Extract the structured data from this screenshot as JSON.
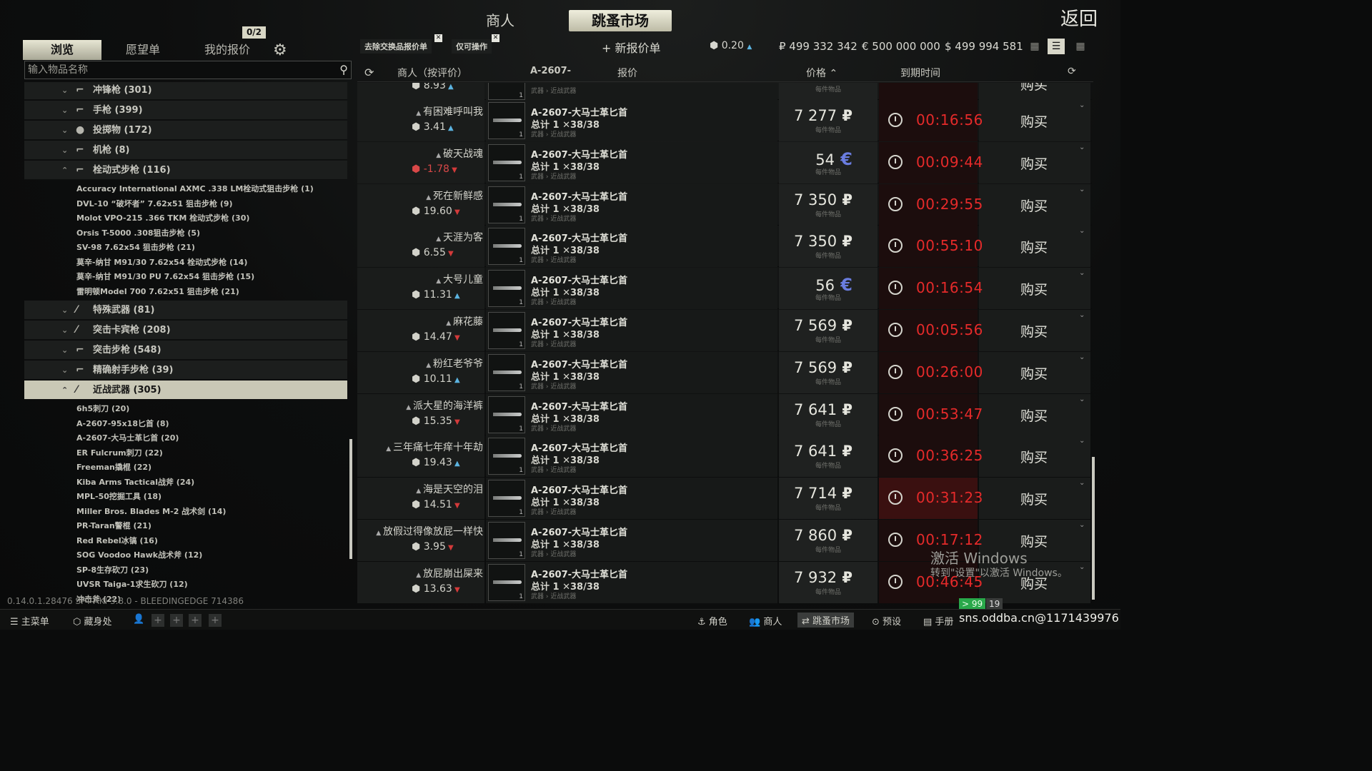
{
  "top": {
    "traders": "商人",
    "flea": "跳蚤市场",
    "back": "返回"
  },
  "left_tabs": {
    "browse": "浏览",
    "wishlist": "愿望单",
    "my_offers": "我的报价",
    "offer_count": "0/2"
  },
  "search": {
    "placeholder": "输入物品名称"
  },
  "categories_top": [
    {
      "label": "冲锋枪 (301)",
      "chev": "⌄",
      "icon": "⌐"
    },
    {
      "label": "手枪 (399)",
      "chev": "⌄",
      "icon": "⌐"
    },
    {
      "label": "投掷物 (172)",
      "chev": "⌄",
      "icon": "●"
    },
    {
      "label": "机枪 (8)",
      "chev": "⌄",
      "icon": "⌐"
    },
    {
      "label": "栓动式步枪 (116)",
      "chev": "⌃",
      "icon": "⌐"
    }
  ],
  "bolt_subitems": [
    "Accuracy International AXMC .338 LM栓动式狙击步枪 (1)",
    "DVL-10 “破坏者” 7.62x51 狙击步枪 (9)",
    "Molot VPO-215 .366 TKM 栓动式步枪 (30)",
    "Orsis T-5000 .308狙击步枪 (5)",
    "SV-98 7.62x54 狙击步枪 (21)",
    "莫辛-纳甘 M91/30 7.62x54 栓动式步枪 (14)",
    "莫辛-纳甘 M91/30 PU 7.62x54 狙击步枪 (15)",
    "雷明顿Model 700 7.62x51 狙击步枪 (21)"
  ],
  "categories_mid": [
    {
      "label": "特殊武器 (81)",
      "chev": "⌄",
      "icon": "⁄"
    },
    {
      "label": "突击卡宾枪 (208)",
      "chev": "⌄",
      "icon": "⁄"
    },
    {
      "label": "突击步枪 (548)",
      "chev": "⌄",
      "icon": "⌐"
    },
    {
      "label": "精确射手步枪 (39)",
      "chev": "⌄",
      "icon": "⌐"
    },
    {
      "label": "近战武器 (305)",
      "chev": "⌃",
      "icon": "⁄"
    }
  ],
  "melee_subitems": [
    "6h5刺刀 (20)",
    "A-2607-95x18匕首 (8)",
    "A-2607-大马士革匕首 (20)",
    "ER Fulcrum刺刀 (22)",
    "Freeman撬棍 (22)",
    "Kiba Arms Tactical战斧 (24)",
    "MPL-50挖掘工具 (18)",
    "Miller Bros. Blades M-2 战术剑 (14)",
    "PR-Taran警棍 (21)",
    "Red Rebel冰镐 (16)",
    "SOG Voodoo Hawk战术斧 (12)",
    "SP-8生存砍刀 (23)",
    "UVSR Taiga-1求生砍刀 (12)",
    "冲击斧 (22)"
  ],
  "toolbar": {
    "chip1": "去除交换品报价单",
    "chip2": "仅可操作",
    "new_offer": "+ 新报价单",
    "rating_val": "0.20",
    "rub": "₽ 499 332 342",
    "eur": "€ 500 000 000",
    "usd": "$ 499 994 581"
  },
  "table_head": {
    "seller": "商人（按评价）",
    "filter_id": "A-2607-",
    "offer": "报价",
    "price": "价格 ⌃",
    "expires": "到期时间"
  },
  "partial_row": {
    "rating": "8.93",
    "price_sub": "每件物品",
    "buy": "购买"
  },
  "offers": [
    {
      "seller": "有困难呼叫我",
      "rating": "3.41",
      "trend": "up",
      "price": "7 277",
      "cur": "rub",
      "time": "00:16:56"
    },
    {
      "seller": "破天战魂",
      "rating": "-1.78",
      "trend": "down",
      "price": "54",
      "cur": "eur",
      "time": "00:09:44"
    },
    {
      "seller": "死在新鲜感",
      "rating": "19.60",
      "trend": "down",
      "price": "7 350",
      "cur": "rub",
      "time": "00:29:55"
    },
    {
      "seller": "天涯为客",
      "rating": "6.55",
      "trend": "down",
      "price": "7 350",
      "cur": "rub",
      "time": "00:55:10"
    },
    {
      "seller": "大号儿童",
      "rating": "11.31",
      "trend": "up",
      "price": "56",
      "cur": "eur",
      "time": "00:16:54"
    },
    {
      "seller": "麻花藤",
      "rating": "14.47",
      "trend": "down",
      "price": "7 569",
      "cur": "rub",
      "time": "00:05:56"
    },
    {
      "seller": "粉红老爷爷",
      "rating": "10.11",
      "trend": "up",
      "price": "7 569",
      "cur": "rub",
      "time": "00:26:00"
    },
    {
      "seller": "派大星的海洋裤",
      "rating": "15.35",
      "trend": "down",
      "price": "7 641",
      "cur": "rub",
      "time": "00:53:47"
    },
    {
      "seller": "三年痛七年痒十年劫",
      "rating": "19.43",
      "trend": "up",
      "price": "7 641",
      "cur": "rub",
      "time": "00:36:25"
    },
    {
      "seller": "海是天空的泪",
      "rating": "14.51",
      "trend": "down",
      "price": "7 714",
      "cur": "rub",
      "time": "00:31:23"
    },
    {
      "seller": "放假过得像放屁一样快",
      "rating": "3.95",
      "trend": "down",
      "price": "7 860",
      "cur": "rub",
      "time": "00:17:12"
    },
    {
      "seller": "放屁崩出屎来",
      "rating": "13.63",
      "trend": "down",
      "price": "7 932",
      "cur": "rub",
      "time": "00:46:45"
    }
  ],
  "offer_item": {
    "name": "A-2607-大马士革匕首",
    "total": "总计 1  ✕38/38",
    "category": "武器 › 近战武器",
    "qty": "1",
    "per_item": "每件物品",
    "buy": "购买"
  },
  "symbols": {
    "rub": "₽",
    "eur": "€",
    "up": "▲",
    "down": "▼",
    "user": "▲",
    "clock": "clock-icon"
  },
  "version": "0.14.0.1.28476 SPT-AKI 3.8.0 - BLEEDINGEDGE 714386",
  "bottom": {
    "menu": "主菜单",
    "hideout": "藏身处",
    "character": "角色",
    "traders": "商人",
    "flea": "跳蚤市场",
    "presets": "预设",
    "handbook": "手册",
    "badge_a": "> 99",
    "badge_b": "19"
  },
  "watermark": {
    "line1": "激活 Windows",
    "line2": "转到\"设置\"以激活 Windows。"
  },
  "credit": "sns.oddba.cn@1171439976",
  "colors": {
    "timer": "#e52a2a",
    "euro": "#6a7de0",
    "up": "#5bb3e0",
    "down": "#d33a3a",
    "accent": "#c9c8b6"
  }
}
